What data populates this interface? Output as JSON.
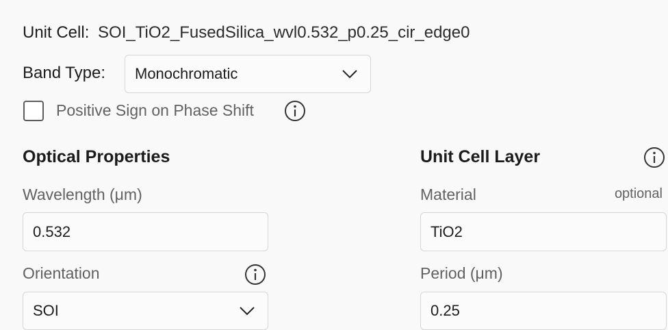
{
  "unit_cell": {
    "label": "Unit Cell:",
    "value": "SOI_TiO2_FusedSilica_wvl0.532_p0.25_cir_edge0"
  },
  "band_type": {
    "label": "Band Type:",
    "selected": "Monochromatic"
  },
  "phase_shift": {
    "label": "Positive Sign on Phase Shift",
    "checked": false
  },
  "optical": {
    "heading": "Optical Properties",
    "wavelength_label": "Wavelength (μm)",
    "wavelength_value": "0.532",
    "orientation_label": "Orientation",
    "orientation_selected": "SOI"
  },
  "layer": {
    "heading": "Unit Cell Layer",
    "material_label": "Material",
    "material_optional": "optional",
    "material_value": "TiO2",
    "period_label": "Period (μm)",
    "period_value": "0.25"
  },
  "icons": {
    "info": "info-circle-icon",
    "dropdown": "chevron-down-icon",
    "checkbox": "checkbox-unchecked"
  }
}
